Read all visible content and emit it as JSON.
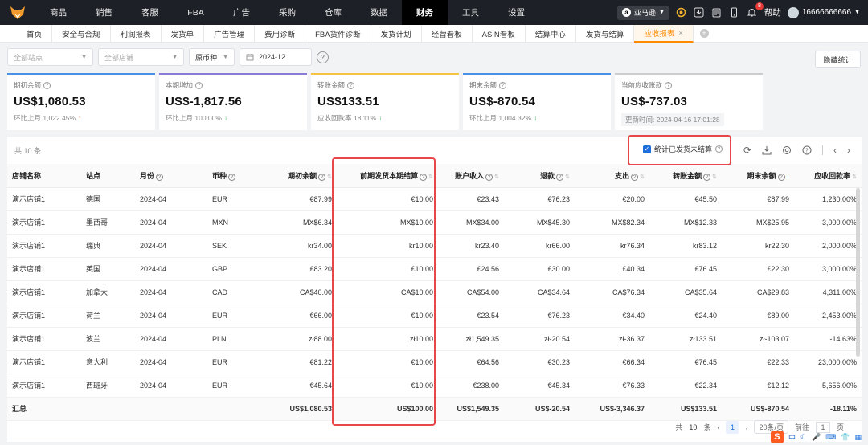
{
  "nav": {
    "menu": [
      "商品",
      "销售",
      "客服",
      "FBA",
      "广告",
      "采购",
      "仓库",
      "数据",
      "财务",
      "工具",
      "设置"
    ],
    "active": "财务",
    "platform": "亚马逊",
    "notification_count": "8",
    "help": "帮助",
    "user": "16666666666"
  },
  "tabs": {
    "items": [
      "首页",
      "安全与合规",
      "利润报表",
      "发货单",
      "广告管理",
      "费用诊断",
      "FBA货件诊断",
      "发货计划",
      "经营看板",
      "ASIN看板",
      "结算中心",
      "发货与结算",
      "应收报表"
    ],
    "active": "应收报表"
  },
  "filters": {
    "site_placeholder": "全部站点",
    "shop_placeholder": "全部店铺",
    "currency": "原币种",
    "month": "2024-12",
    "hide_button": "隐藏统计"
  },
  "cards": [
    {
      "label": "期初余额",
      "value": "US$1,080.53",
      "sub": "环比上月 1,022.45%",
      "trend": "up",
      "color": "#4a90e2"
    },
    {
      "label": "本期增加",
      "value": "US$-1,817.56",
      "sub": "环比上月 100.00%",
      "trend": "down",
      "color": "#8a7ad8"
    },
    {
      "label": "转账金额",
      "value": "US$133.51",
      "sub": "应收回款率 18.11%",
      "trend": "down",
      "color": "#f5c242"
    },
    {
      "label": "期末余额",
      "value": "US$-870.54",
      "sub": "环比上月 1,004.32%",
      "trend": "down",
      "color": "#4a90e2"
    },
    {
      "label": "当前应收账款",
      "value": "US$-737.03",
      "sub": "更新时间: 2024-04-16 17:01:28",
      "trend": "",
      "color": "#cccccc"
    }
  ],
  "table": {
    "total": "共 10 条",
    "stat_check_label": "统计已发货未结算",
    "columns": [
      "店铺名称",
      "站点",
      "月份",
      "币种",
      "期初余额",
      "前期发货本期结算",
      "账户收入",
      "退款",
      "支出",
      "转账金额",
      "期末余额",
      "应收回款率"
    ],
    "rows": [
      [
        "演示店铺1",
        "德国",
        "2024-04",
        "EUR",
        "€87.99",
        "€10.00",
        "€23.43",
        "€76.23",
        "€20.00",
        "€45.50",
        "€87.99",
        "1,230.00%"
      ],
      [
        "演示店铺1",
        "墨西哥",
        "2024-04",
        "MXN",
        "MX$6.34",
        "MX$10.00",
        "MX$34.00",
        "MX$45.30",
        "MX$82.34",
        "MX$12.33",
        "MX$25.95",
        "3,000.00%"
      ],
      [
        "演示店铺1",
        "瑞典",
        "2024-04",
        "SEK",
        "kr34.00",
        "kr10.00",
        "kr23.40",
        "kr66.00",
        "kr76.34",
        "kr83.12",
        "kr22.30",
        "2,000.00%"
      ],
      [
        "演示店铺1",
        "英国",
        "2024-04",
        "GBP",
        "£83.20",
        "£10.00",
        "£24.56",
        "£30.00",
        "£40.34",
        "£76.45",
        "£22.30",
        "3,000.00%"
      ],
      [
        "演示店铺1",
        "加拿大",
        "2024-04",
        "CAD",
        "CA$40.00",
        "CA$10.00",
        "CA$54.00",
        "CA$34.64",
        "CA$76.34",
        "CA$35.64",
        "CA$29.83",
        "4,311.00%"
      ],
      [
        "演示店铺1",
        "荷兰",
        "2024-04",
        "EUR",
        "€66.00",
        "€10.00",
        "€23.54",
        "€76.23",
        "€34.40",
        "€24.40",
        "€89.00",
        "2,453.00%"
      ],
      [
        "演示店铺1",
        "波兰",
        "2024-04",
        "PLN",
        "zł88.00",
        "zł10.00",
        "zł1,549.35",
        "zł-20.54",
        "zł-36.37",
        "zł133.51",
        "zł-103.07",
        "-14.63%"
      ],
      [
        "演示店铺1",
        "意大利",
        "2024-04",
        "EUR",
        "€81.22",
        "€10.00",
        "€64.56",
        "€30.23",
        "€66.34",
        "€76.45",
        "€22.33",
        "23,000.00%"
      ],
      [
        "演示店铺1",
        "西班牙",
        "2024-04",
        "EUR",
        "€45.64",
        "€10.00",
        "€238.00",
        "€45.34",
        "€76.33",
        "€22.34",
        "€12.12",
        "5,656.00%"
      ]
    ],
    "summary": [
      "汇总",
      "",
      "",
      "",
      "US$1,080.53",
      "US$100.00",
      "US$1,549.35",
      "US$-20.54",
      "US$-3,346.37",
      "US$133.51",
      "US$-870.54",
      "-18.11%"
    ]
  },
  "pager": {
    "total_prefix": "共",
    "total": "10",
    "total_suffix": "条",
    "current": "1",
    "page_size": "20条/页",
    "goto": "前往",
    "goto_value": "1",
    "page_suffix": "页"
  },
  "ime": {
    "lang": "中"
  }
}
